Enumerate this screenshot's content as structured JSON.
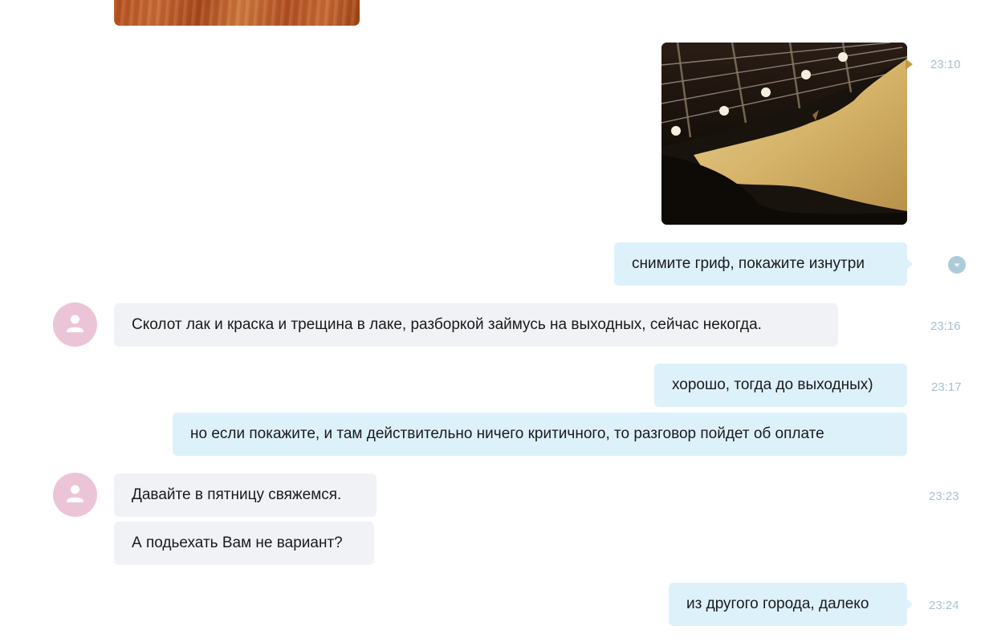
{
  "messages": [
    {
      "id": "m1",
      "direction": "incoming",
      "type": "photo",
      "subject": "wood"
    },
    {
      "id": "m2",
      "direction": "outgoing",
      "type": "photo",
      "subject": "guitar-neck-closeup",
      "time": "23:10"
    },
    {
      "id": "m3",
      "direction": "outgoing",
      "type": "text",
      "text": "снимите гриф, покажите изнутри",
      "status": "chevron-down-icon"
    },
    {
      "id": "m4",
      "direction": "incoming",
      "type": "text",
      "text": "Сколот лак и краска и трещина в лаке, разборкой займусь на выходных, сейчас некогда.",
      "time": "23:16"
    },
    {
      "id": "m5",
      "direction": "outgoing",
      "type": "text",
      "text": "хорошо, тогда до выходных)",
      "time": "23:17"
    },
    {
      "id": "m6",
      "direction": "outgoing",
      "type": "text",
      "text": "но если покажите, и там действительно ничего критичного, то разговор пойдет об оплате"
    },
    {
      "id": "m7",
      "direction": "incoming",
      "type": "text",
      "text": "Давайте в пятницу свяжемся.",
      "time": "23:23"
    },
    {
      "id": "m8",
      "direction": "incoming",
      "type": "text",
      "text": "А подьехать Вам не вариант?"
    },
    {
      "id": "m9",
      "direction": "outgoing",
      "type": "text",
      "text": "из другого города, далеко",
      "time": "23:24"
    }
  ],
  "colors": {
    "outgoing_bubble": "#ddf1fb",
    "incoming_bubble": "#f0f2f5",
    "avatar": "#ecc4d8",
    "timestamp": "#a9c1d1"
  },
  "icons": {
    "avatar": "user-silhouette-icon",
    "status": "chevron-down-icon"
  }
}
